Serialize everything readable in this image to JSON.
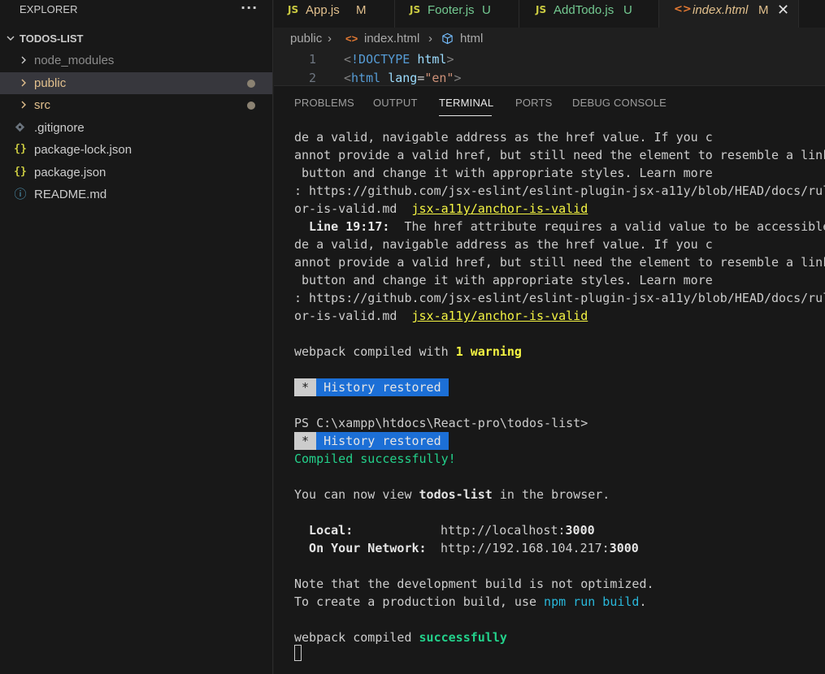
{
  "sidebar": {
    "title": "EXPLORER",
    "more": "···",
    "project": "TODOS-LIST",
    "items": [
      {
        "label": "node_modules",
        "type": "folder"
      },
      {
        "label": "public",
        "type": "folder"
      },
      {
        "label": "src",
        "type": "folder"
      },
      {
        "label": ".gitignore",
        "type": "git"
      },
      {
        "label": "package-lock.json",
        "type": "json",
        "icon": "{}"
      },
      {
        "label": "package.json",
        "type": "json",
        "icon": "{}"
      },
      {
        "label": "README.md",
        "type": "info",
        "icon": "ⓘ"
      }
    ]
  },
  "tabs": [
    {
      "icon": "JS",
      "name": "App.js",
      "status": "M"
    },
    {
      "icon": "JS",
      "name": "Footer.js",
      "status": "U"
    },
    {
      "icon": "JS",
      "name": "AddTodo.js",
      "status": "U"
    },
    {
      "icon": "<>",
      "name": "index.html",
      "status": "M",
      "close": "✕"
    }
  ],
  "breadcrumb": {
    "folder": "public",
    "sep": "›",
    "file": "index.html",
    "symbol": "html"
  },
  "editor": {
    "lines": [
      {
        "num": "1",
        "text": "<!DOCTYPE html>"
      },
      {
        "num": "2",
        "text": "<html lang=\"en\">"
      }
    ]
  },
  "panel": {
    "tabs": [
      "PROBLEMS",
      "OUTPUT",
      "TERMINAL",
      "PORTS",
      "DEBUG CONSOLE"
    ],
    "active": "TERMINAL"
  },
  "terminal": {
    "l1": "de a valid, navigable address as the href value. If you c",
    "l2": "annot provide a valid href, but still need the element to resemble a link, use a",
    "l3": " button and change it with appropriate styles. Learn more",
    "l4": ": https://github.com/jsx-eslint/eslint-plugin-jsx-a11y/blob/HEAD/docs/rules/anch",
    "l5a": "or-is-valid.md  ",
    "l5b": "jsx-a11y/anchor-is-valid",
    "l6a": "  Line 19:17:",
    "l6b": "  The href attribute requires a valid value to be accessible. Provi",
    "l7": "de a valid, navigable address as the href value. If you c",
    "l8": "annot provide a valid href, but still need the element to resemble a link, use a",
    "l9": " button and change it with appropriate styles. Learn more",
    "l10": ": https://github.com/jsx-eslint/eslint-plugin-jsx-a11y/blob/HEAD/docs/rules/anch",
    "l11a": "or-is-valid.md  ",
    "l11b": "jsx-a11y/anchor-is-valid",
    "l12a": "webpack compiled with ",
    "l12b": "1 warning",
    "hist_star": " * ",
    "hist_text": " History restored ",
    "prompt": "PS C:\\xampp\\htdocs\\React-pro\\todos-list>",
    "compiled": "Compiled successfully!",
    "view_a": "You can now view ",
    "view_b": "todos-list",
    "view_c": " in the browser.",
    "local_label": "  Local:",
    "local_url_a": "http://localhost:",
    "local_url_b": "3000",
    "network_label": "  On Your Network:",
    "network_url_a": "http://192.168.104.217:",
    "network_url_b": "3000",
    "note1": "Note that the development build is not optimized.",
    "note2a": "To create a production build, use ",
    "note2b": "npm run build",
    "note2c": ".",
    "final_a": "webpack compiled ",
    "final_b": "successfully"
  },
  "colors": {
    "background": "#1e1e1e",
    "sidebar": "#181818",
    "selected": "#37373d",
    "js_icon": "#cbcb41",
    "html_icon": "#e37933",
    "modified": "#e2c08d",
    "untracked": "#73c991",
    "link_yellow": "#f5f543",
    "success_green": "#23d18b",
    "accent_blue": "#1c6fd6"
  }
}
